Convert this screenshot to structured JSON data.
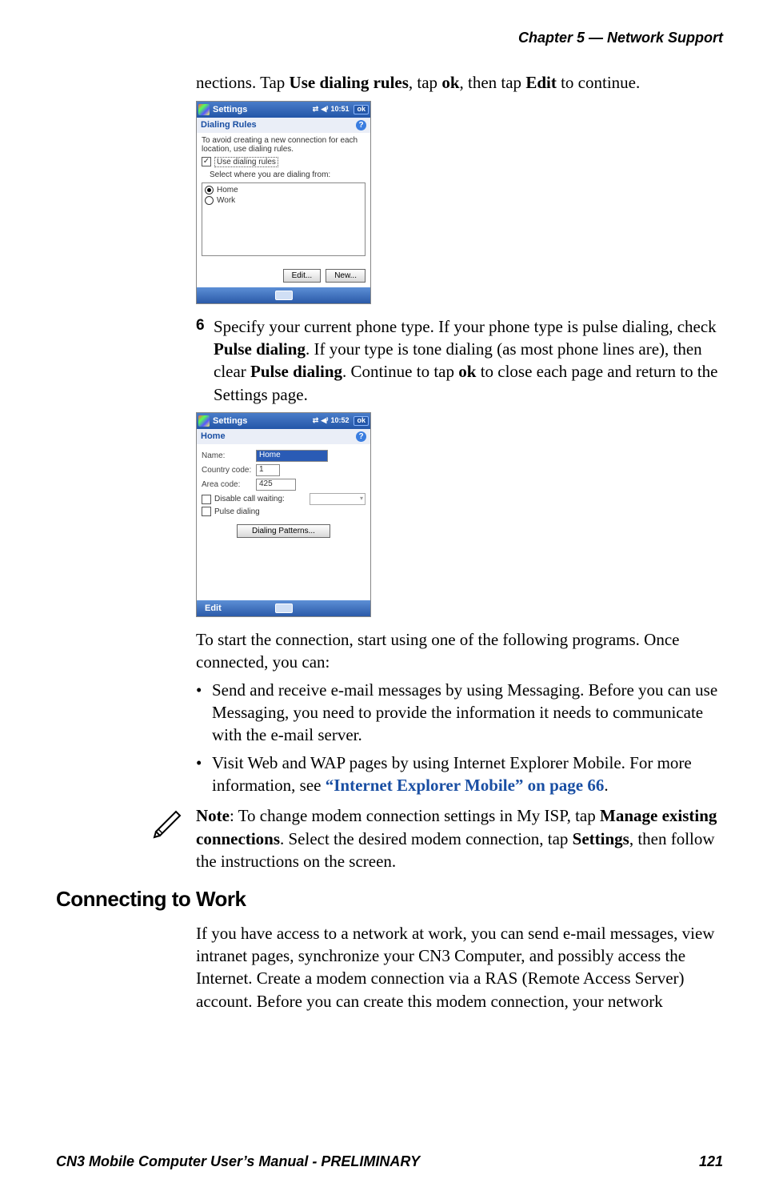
{
  "running_head": "Chapter 5 —  Network Support",
  "intro_fragment_1": "nections. Tap ",
  "intro_b1": "Use dialing rules",
  "intro_fragment_2": ", tap ",
  "intro_b2": "ok",
  "intro_fragment_3": ", then tap ",
  "intro_b3": "Edit",
  "intro_fragment_4": " to continue.",
  "screenshot1": {
    "titlebar_title": "Settings",
    "time": "10:51",
    "ok": "ok",
    "subhead": "Dialing Rules",
    "note_text": "To avoid creating a new connection for each location, use dialing rules.",
    "check_label": "Use dialing rules",
    "check_checked": "✓",
    "prompt": "Select where you are dialing from:",
    "radio1": "Home",
    "radio2": "Work",
    "btn_edit": "Edit...",
    "btn_new": "New..."
  },
  "step6_num": "6",
  "step6_a": "Specify your current phone type. If your phone type is pulse dialing, check ",
  "step6_b1": "Pulse dialing",
  "step6_c": ". If your type is tone dialing (as most phone lines are), then clear ",
  "step6_b2": "Pulse dialing",
  "step6_d": ". Continue to tap ",
  "step6_b3": "ok",
  "step6_e": " to close each page and return to the Settings page.",
  "screenshot2": {
    "titlebar_title": "Settings",
    "time": "10:52",
    "ok": "ok",
    "subhead": "Home",
    "lbl_name": "Name:",
    "val_name": "Home",
    "lbl_country": "Country code:",
    "val_country": "1",
    "lbl_area": "Area code:",
    "val_area": "425",
    "lbl_disable": "Disable call waiting:",
    "lbl_pulse": "Pulse dialing",
    "btn_patterns": "Dialing Patterns...",
    "soft_edit": "Edit"
  },
  "para_after": "To start the connection, start using one of the following programs. Once connected, you can:",
  "bullet1": "Send and receive e-mail messages by using Messaging. Before you can use Messaging, you need to provide the information it needs to communicate with the e-mail server.",
  "bullet2_a": "Visit Web and WAP pages by using Internet Explorer Mobile. For more information, see ",
  "bullet2_link": "“Internet Explorer Mobile” on page 66",
  "bullet2_b": ".",
  "note_b1": "Note",
  "note_a": ": To change modem connection settings in My ISP, tap ",
  "note_b2": "Manage existing connections",
  "note_c": ". Select the desired modem connection, tap ",
  "note_b3": "Settings",
  "note_d": ", then follow the instructions on the screen.",
  "section_heading": "Connecting to Work",
  "work_para": "If you have access to a network at work, you can send e-mail messages, view intranet pages, synchronize your CN3 Computer, and possibly access the Internet. Create a modem connection via a RAS (Remote Access Server) account. Before you can create this modem connection, your network",
  "footer_left": "CN3 Mobile Computer User’s Manual - PRELIMINARY",
  "footer_right": "121"
}
